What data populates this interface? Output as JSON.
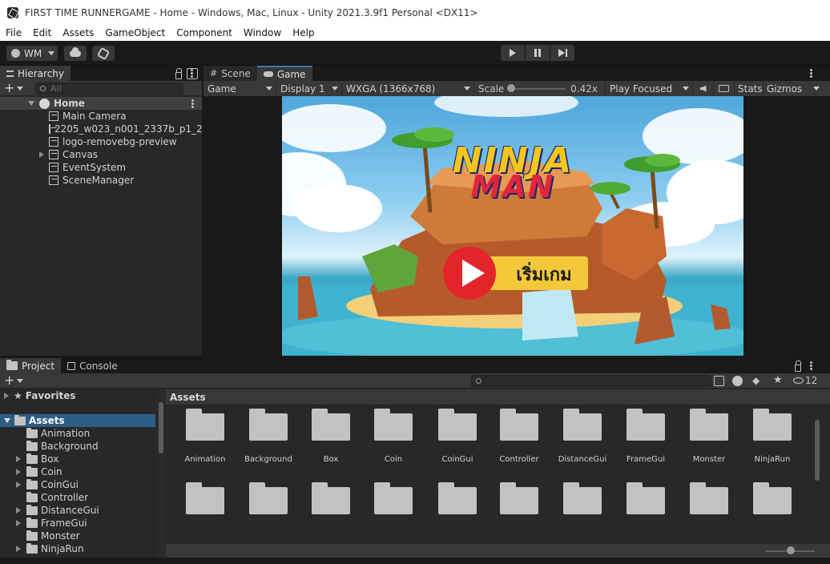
{
  "window": {
    "title": "FIRST TIME RUNNERGAME - Home - Windows, Mac, Linux - Unity 2021.3.9f1 Personal <DX11>"
  },
  "menu": [
    "File",
    "Edit",
    "Assets",
    "GameObject",
    "Component",
    "Window",
    "Help"
  ],
  "toolbar": {
    "account_label": "WM"
  },
  "hierarchy": {
    "tab_label": "Hierarchy",
    "search_placeholder": "All",
    "scene_name": "Home",
    "objects": [
      {
        "name": "Main Camera",
        "expandable": false
      },
      {
        "name": "2205_w023_n001_2337b_p1_2",
        "expandable": false
      },
      {
        "name": "logo-removebg-preview",
        "expandable": false
      },
      {
        "name": "Canvas",
        "expandable": true
      },
      {
        "name": "EventSystem",
        "expandable": false
      },
      {
        "name": "SceneManager",
        "expandable": false
      }
    ]
  },
  "game_view": {
    "tabs": [
      "Scene",
      "Game"
    ],
    "active_tab": "Game",
    "mode": "Game",
    "display": "Display 1",
    "resolution": "WXGA (1366x768)",
    "scale_label": "Scale",
    "scale_value": "0.42x",
    "play_mode": "Play Focused",
    "stats_label": "Stats",
    "gizmos_label": "Gizmos",
    "game_title_line1": "NINJA",
    "game_title_line2": "MAN",
    "start_button_text": "เริ่มเกม"
  },
  "project": {
    "tabs": [
      "Project",
      "Console"
    ],
    "active_tab": "Project",
    "hidden_count": "12",
    "breadcrumb": "Assets",
    "favorites_label": "Favorites",
    "assets_label": "Assets",
    "tree_items": [
      {
        "name": "Animation",
        "expandable": false
      },
      {
        "name": "Background",
        "expandable": false
      },
      {
        "name": "Box",
        "expandable": true
      },
      {
        "name": "Coin",
        "expandable": true
      },
      {
        "name": "CoinGui",
        "expandable": true
      },
      {
        "name": "Controller",
        "expandable": false
      },
      {
        "name": "DistanceGui",
        "expandable": true
      },
      {
        "name": "FrameGui",
        "expandable": true
      },
      {
        "name": "Monster",
        "expandable": false
      },
      {
        "name": "NinjaRun",
        "expandable": true
      }
    ],
    "grid_folders": [
      "Animation",
      "Background",
      "Box",
      "Coin",
      "CoinGui",
      "Controller",
      "DistanceGui",
      "FrameGui",
      "Monster",
      "NinjaRun"
    ]
  },
  "colors": {
    "accent": "#3a79bb",
    "selection": "#2c5d87",
    "play_button_red": "#e3242b",
    "start_bar_yellow": "#f3c83b"
  }
}
